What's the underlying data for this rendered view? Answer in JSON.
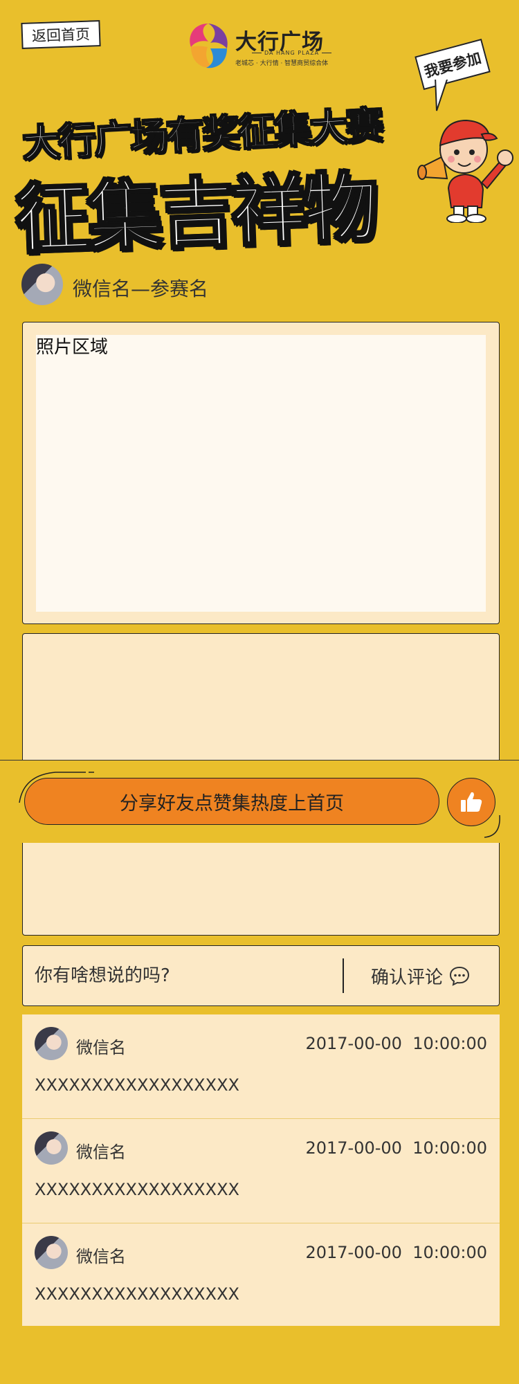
{
  "header": {
    "back_label": "返回首页",
    "logo": {
      "name": "大行广场",
      "subtitle_en": "DA HANG PLAZA",
      "tagline": "老城芯 · 大行情 · 智慧商贸综合体",
      "colors": [
        "#E63B7A",
        "#F3A530",
        "#2C8BD6",
        "#7B3FA0"
      ]
    },
    "join_bubble": "我要参加"
  },
  "banner": {
    "line1": "大行广场有奖征集大赛",
    "line2": "征集吉祥物"
  },
  "entry": {
    "title": "微信名—参赛名",
    "photo_label": "照片区域"
  },
  "share": {
    "label": "分享好友点赞集热度上首页",
    "like_icon": "thumbs-up-icon"
  },
  "comment_form": {
    "placeholder": "你有啥想说的吗?",
    "confirm_label": "确认评论",
    "confirm_icon": "speech-bubble-icon"
  },
  "comments": [
    {
      "name": "微信名",
      "time": "2017-00-00  10:00:00",
      "text": "XXXXXXXXXXXXXXXXXX"
    },
    {
      "name": "微信名",
      "time": "2017-00-00  10:00:00",
      "text": "XXXXXXXXXXXXXXXXXX"
    },
    {
      "name": "微信名",
      "time": "2017-00-00  10:00:00",
      "text": "XXXXXXXXXXXXXXXXXX"
    }
  ],
  "colors": {
    "page_bg": "#E9BF2C",
    "panel_bg": "#FCE9C6",
    "accent_orange": "#EF8321"
  }
}
